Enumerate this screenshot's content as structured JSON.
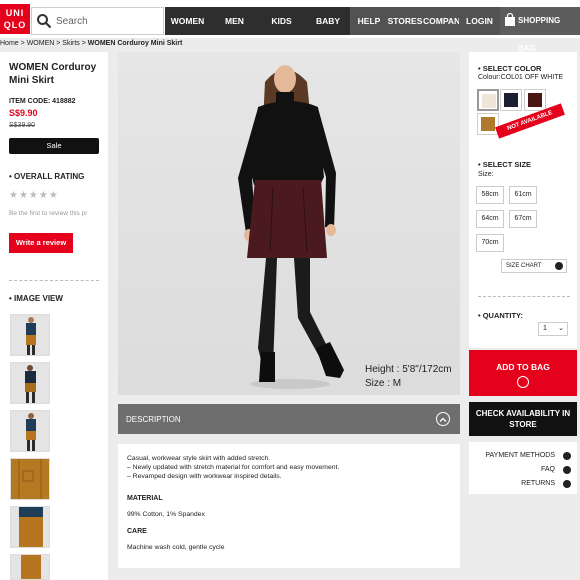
{
  "brand": {
    "logo_line1": "UNI",
    "logo_line2": "QLO"
  },
  "search": {
    "placeholder": "Search"
  },
  "nav": {
    "women": "WOMEN",
    "men": "MEN",
    "kids": "KIDS",
    "baby": "BABY",
    "help": "HELP",
    "stores": "STORES",
    "company": "COMPANY",
    "login": "LOGIN",
    "bag": "SHOPPING BAG"
  },
  "breadcrumb": {
    "home": "Home",
    "sep": ">",
    "women": "WOMEN",
    "skirts": "Skirts",
    "current": "WOMEN Corduroy Mini Skirt"
  },
  "product": {
    "title_line1": "WOMEN Corduroy",
    "title_line2": "Mini Skirt",
    "item_code": "ITEM CODE: 418882",
    "price": "S$9.90",
    "old_price": "S$39.90",
    "sale_label": "Sale",
    "overall_rating_label": "OVERALL RATING",
    "stars": "★★★★★",
    "review_prompt": "Be the first to review this pr",
    "write_review": "Write a review",
    "image_view_label": "IMAGE VIEW"
  },
  "photo": {
    "height_text": "Height : 5'8\"/172cm",
    "size_text": "Size : M"
  },
  "description": {
    "header": "DESCRIPTION",
    "line1": "Casual, workwear style skirt with added stretch.",
    "line2": "– Newly updated with stretch material for comfort and easy movement.",
    "line3": "– Revamped design with workwear inspired details.",
    "material_label": "MATERIAL",
    "material": "99% Cotton, 1% Spandex",
    "care_label": "CARE",
    "care": "Machine wash cold, gentle cycle"
  },
  "options": {
    "select_color": "SELECT COLOR",
    "color_value": "Colour:COL01 OFF WHITE",
    "not_available": "NOT AVAILABLE",
    "swatch_colors": [
      "#efe5d8",
      "#1b1f33",
      "#4a1515",
      "#b07a2c"
    ],
    "select_size": "SELECT SIZE",
    "size_label": "Size:",
    "sizes": [
      "58cm",
      "61cm",
      "64cm",
      "67cm",
      "70cm"
    ],
    "size_chart": "SIZE CHART",
    "quantity_label": "QUANTITY:",
    "quantity_value": "1"
  },
  "actions": {
    "add_to_bag": "ADD TO BAG",
    "check_line1": "CHECK AVAILABILITY IN",
    "check_line2": "STORE",
    "payment": "PAYMENT METHODS",
    "faq": "FAQ",
    "returns": "RETURNS"
  },
  "colors": {
    "brand_red": "#e5001c",
    "nav_dark": "#2e2e2e"
  }
}
